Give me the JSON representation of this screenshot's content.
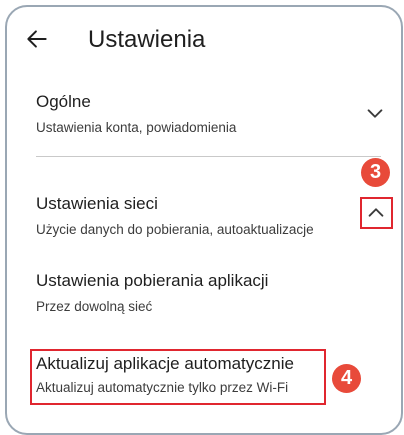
{
  "header": {
    "title": "Ustawienia"
  },
  "settings": {
    "general": {
      "title": "Ogólne",
      "subtitle": "Ustawienia konta, powiadomienia",
      "chevron": "chevron-down-icon"
    },
    "network": {
      "title": "Ustawienia sieci",
      "subtitle": "Użycie danych do pobierania, autoaktualizacje",
      "chevron": "chevron-up-icon"
    },
    "app_download": {
      "title": "Ustawienia pobierania aplikacji",
      "subtitle": "Przez dowolną sieć"
    },
    "auto_update": {
      "title": "Aktualizuj aplikacje automatycznie",
      "subtitle": "Aktualizuj automatycznie tylko przez Wi-Fi"
    }
  },
  "annotations": {
    "step3": "3",
    "step4": "4"
  },
  "colors": {
    "badge": "#e84a3a",
    "highlight": "#e0262f",
    "frame": "#9aa7b4"
  }
}
